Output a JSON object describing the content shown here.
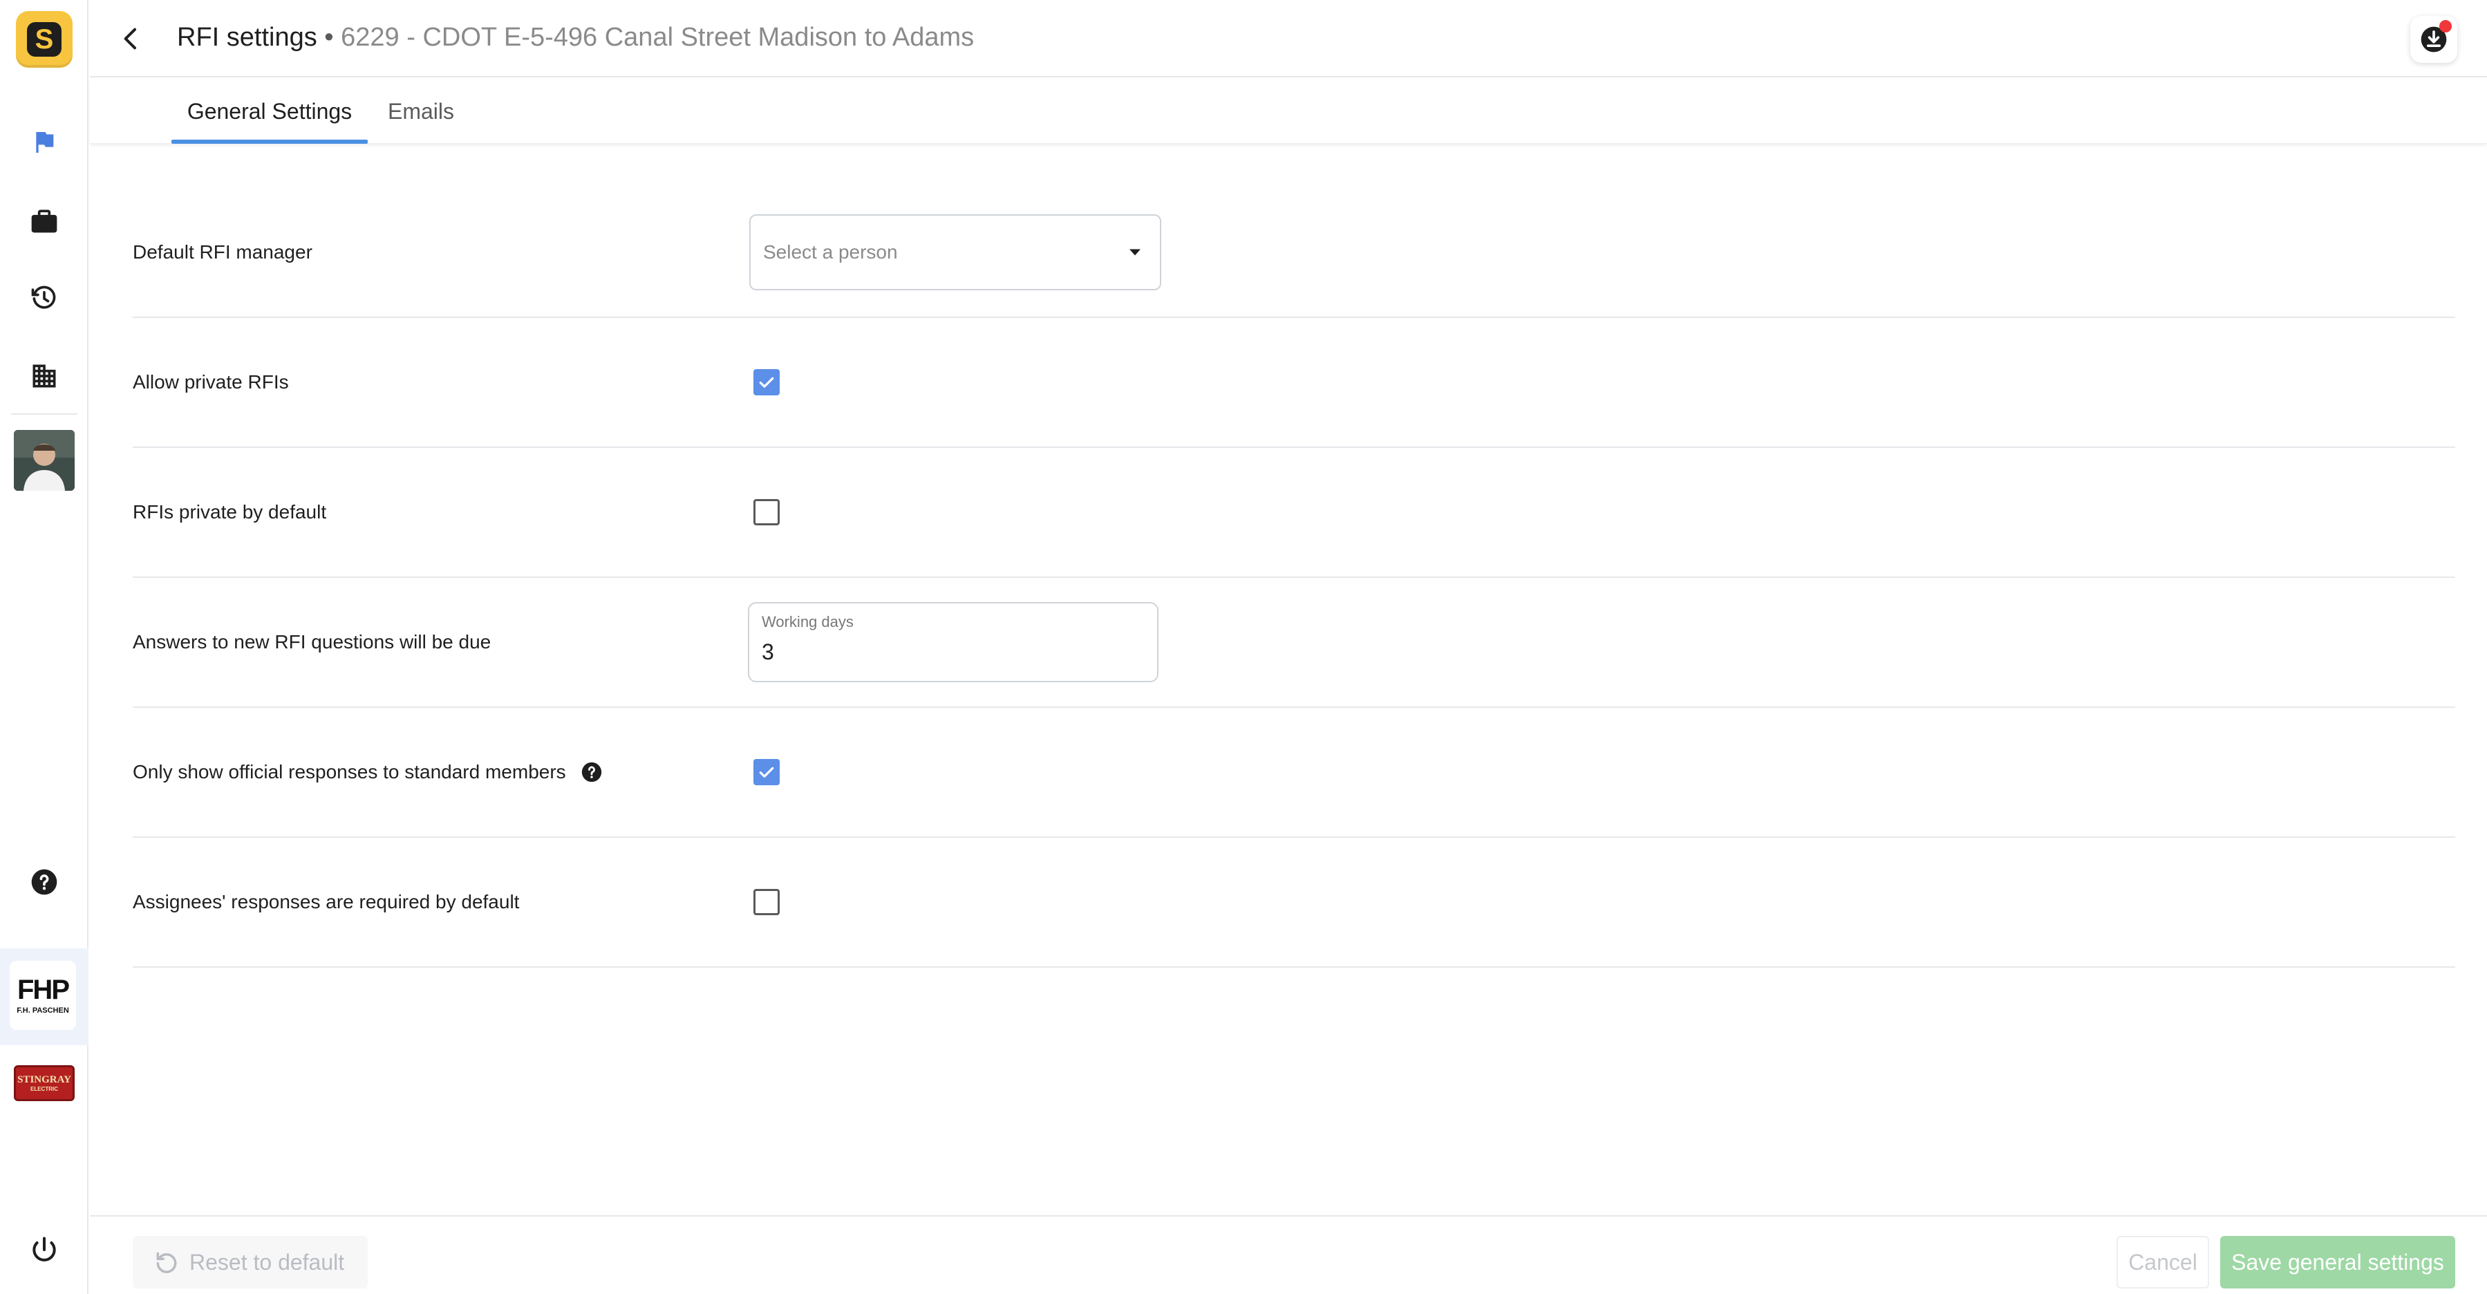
{
  "app": {
    "logo_letter": "S"
  },
  "header": {
    "title": "RFI settings",
    "separator": " • ",
    "project": "6229 - CDOT E-5-496 Canal Street Madison to Adams"
  },
  "tabs": [
    {
      "label": "General Settings",
      "active": true
    },
    {
      "label": "Emails",
      "active": false
    }
  ],
  "settings": {
    "default_manager": {
      "label": "Default RFI manager",
      "placeholder": "Select a person"
    },
    "allow_private": {
      "label": "Allow private RFIs",
      "checked": true
    },
    "private_default": {
      "label": "RFIs private by default",
      "checked": false
    },
    "due_days": {
      "label": "Answers to new RFI questions will be due",
      "field_label": "Working days",
      "value": "3"
    },
    "official_responses": {
      "label": "Only show official responses to standard members",
      "checked": true
    },
    "assignee_required": {
      "label": "Assignees' responses are required by default",
      "checked": false
    }
  },
  "sidebar": {
    "orgs": [
      {
        "name": "F.H. Paschen",
        "mark": "FHP",
        "sub": "F.H. PASCHEN"
      },
      {
        "name": "Stingray Electric",
        "mark": "STINGRAY",
        "sub": "ELECTRIC"
      }
    ]
  },
  "footer": {
    "reset_label": "Reset to default",
    "cancel_label": "Cancel",
    "save_label": "Save general settings"
  },
  "colors": {
    "accent": "#4a90e2",
    "checkbox": "#5b8fe8",
    "brand_yellow": "#f7c53f",
    "save_disabled": "#9ed8a5",
    "notification": "#f0373a"
  }
}
